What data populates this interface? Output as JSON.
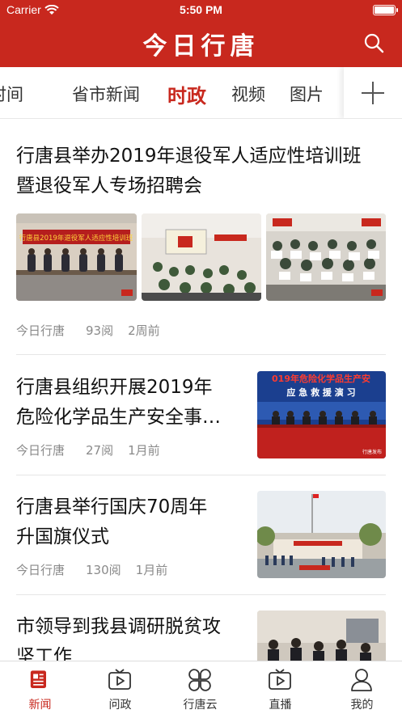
{
  "status_bar": {
    "carrier": "Carrier",
    "time": "5:50 PM"
  },
  "header": {
    "title": "今日行唐"
  },
  "channels": {
    "items": [
      {
        "label": "时间"
      },
      {
        "label": "省市新闻"
      },
      {
        "label": "时政"
      },
      {
        "label": "视频"
      },
      {
        "label": "图片"
      }
    ],
    "active": "时政"
  },
  "articles": [
    {
      "title_lines": [
        "行唐县举办2019年退役军人适应性培训班",
        "暨退役军人专场招聘会"
      ],
      "source": "今日行唐",
      "reads": "93阅",
      "time": "2周前",
      "images": [
        {
          "banner": "行唐县2019年退役军人适应性培训班"
        },
        {
          "banner": ""
        },
        {
          "banner": ""
        }
      ]
    },
    {
      "title_lines": [
        "行唐县组织开展2019年",
        "危险化学品生产安全事…"
      ],
      "source": "今日行唐",
      "reads": "27阅",
      "time": "1月前",
      "image": {
        "banner_line1": "019年危险化学品生产安",
        "banner_line2": "应 急 救 援 演 习",
        "watermark": "行唐发布"
      }
    },
    {
      "title_lines": [
        "行唐县举行国庆70周年",
        "升国旗仪式"
      ],
      "source": "今日行唐",
      "reads": "130阅",
      "time": "1月前"
    },
    {
      "title_lines": [
        "市领导到我县调研脱贫攻",
        "坚工作"
      ]
    }
  ],
  "tabbar": {
    "items": [
      {
        "label": "新闻",
        "icon": "news-icon"
      },
      {
        "label": "问政",
        "icon": "tv-play-icon"
      },
      {
        "label": "行唐云",
        "icon": "clover-grid-icon"
      },
      {
        "label": "直播",
        "icon": "live-tv-icon"
      },
      {
        "label": "我的",
        "icon": "person-icon"
      }
    ],
    "active": "新闻"
  },
  "colors": {
    "brand_red": "#c8281e",
    "meta_gray": "#8a8a8a"
  }
}
